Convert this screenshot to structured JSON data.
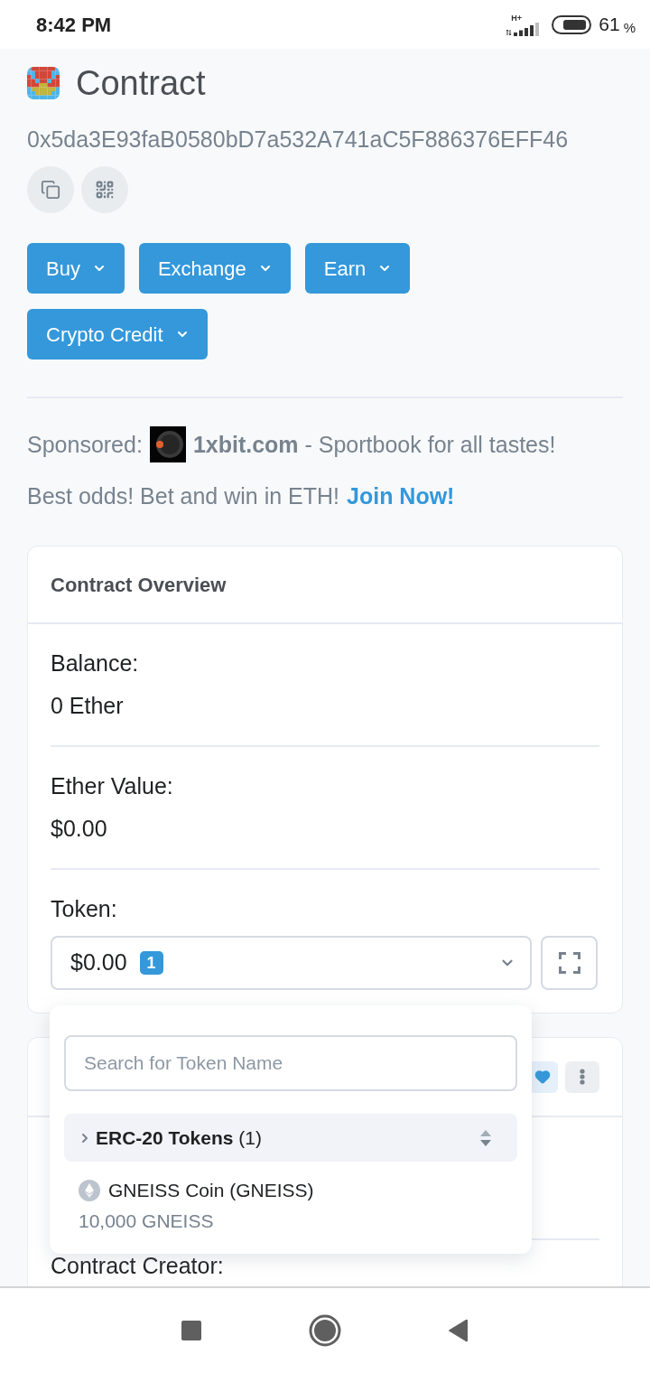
{
  "status_bar": {
    "time": "8:42 PM",
    "network": "H+",
    "battery": "61",
    "battery_unit": "%"
  },
  "header": {
    "title": "Contract",
    "address": "0x5da3E93faB0580bD7a532A741aC5F886376EFF46"
  },
  "menu_buttons": [
    {
      "label": "Buy"
    },
    {
      "label": "Exchange"
    },
    {
      "label": "Earn"
    },
    {
      "label": "Crypto Credit"
    }
  ],
  "sponsor": {
    "prefix": "Sponsored:",
    "text": "**1xbit.com** - Sportbook for all tastes!",
    "tagline": "Best odds! Bet and win in ETH!",
    "link": "Join Now!"
  },
  "overview": {
    "title": "Contract Overview",
    "fields": [
      {
        "label": "Balance:",
        "value": "0 Ether"
      },
      {
        "label": "Ether Value:",
        "value": "$0.00"
      }
    ],
    "token": {
      "label": "Token:",
      "value": "$0.00",
      "count": "1",
      "expanded": true,
      "search_placeholder": "Search for Token Name",
      "groups": [
        {
          "label": "**ERC-20 Tokens** (1)",
          "items": [
            {
              "name": "GNEISS Coin (GNEISS)",
              "amount": "10,000 GNEISS"
            }
          ]
        }
      ]
    }
  },
  "more_info": {
    "creator_label": "Contract Creator:"
  }
}
